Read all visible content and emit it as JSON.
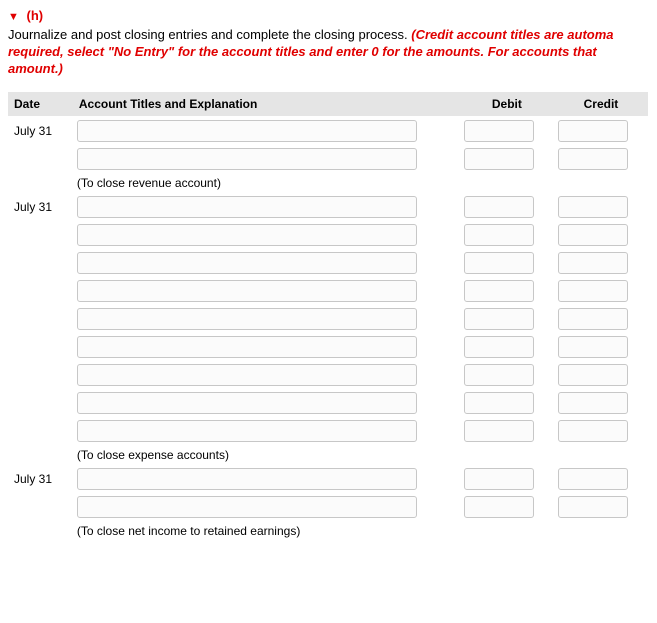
{
  "header": {
    "triangle": "▼",
    "label": "(h)"
  },
  "instructions": {
    "plain": "Journalize and post closing entries and complete the closing process. ",
    "emph": "(Credit account titles are automa required, select \"No Entry\" for the account titles and enter 0 for the amounts. For accounts that amount.)"
  },
  "table": {
    "headers": {
      "date": "Date",
      "acct": "Account Titles and Explanation",
      "debit": "Debit",
      "credit": "Credit"
    },
    "groups": [
      {
        "date": "July 31",
        "rows": 2,
        "explanation": "(To close revenue account)"
      },
      {
        "date": "July 31",
        "rows": 9,
        "explanation": "(To close expense accounts)"
      },
      {
        "date": "July 31",
        "rows": 2,
        "explanation": "(To close net income to retained earnings)"
      }
    ]
  }
}
